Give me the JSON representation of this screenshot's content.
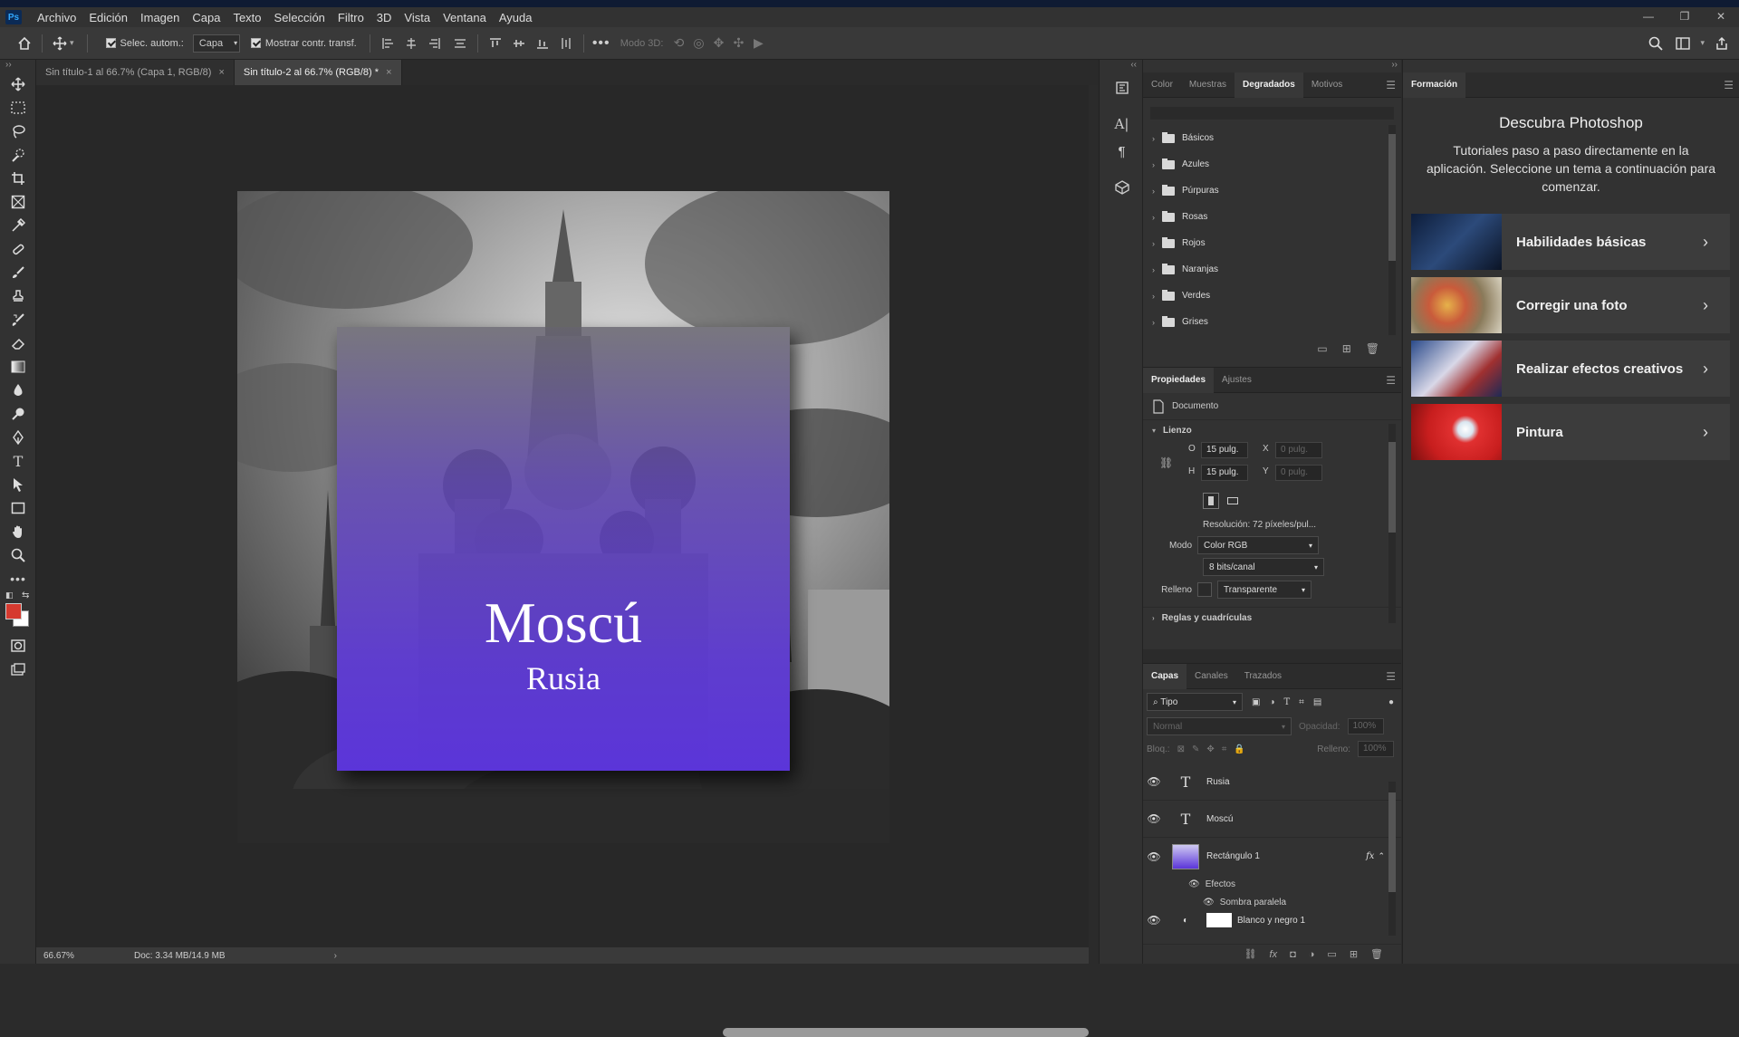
{
  "app": {
    "logo": "Ps"
  },
  "menu": [
    "Archivo",
    "Edición",
    "Imagen",
    "Capa",
    "Texto",
    "Selección",
    "Filtro",
    "3D",
    "Vista",
    "Ventana",
    "Ayuda"
  ],
  "window_controls": [
    "—",
    "❐",
    "✕"
  ],
  "options": {
    "auto_select_label": "Selec. autom.:",
    "auto_select_target": "Capa",
    "show_transform_label": "Mostrar contr. transf.",
    "mode_3d_label": "Modo 3D:"
  },
  "tabs": [
    {
      "label": "Sin título-1 al 66.7% (Capa 1, RGB/8)",
      "close": "×"
    },
    {
      "label": "Sin título-2 al 66.7% (RGB/8) *",
      "close": "×"
    }
  ],
  "artwork": {
    "title": "Moscú",
    "subtitle": "Rusia"
  },
  "status": {
    "zoom": "66.67%",
    "doc": "Doc: 3.34 MB/14.9 MB"
  },
  "gradients_panel": {
    "tabs": [
      "Color",
      "Muestras",
      "Degradados",
      "Motivos"
    ],
    "active_tab": "Degradados",
    "folders": [
      "Básicos",
      "Azules",
      "Púrpuras",
      "Rosas",
      "Rojos",
      "Naranjas",
      "Verdes",
      "Grises"
    ]
  },
  "properties_panel": {
    "tabs": [
      "Propiedades",
      "Ajustes"
    ],
    "doc_label": "Documento",
    "section_canvas": "Lienzo",
    "w_label": "O",
    "w_value": "15 pulg.",
    "h_label": "H",
    "h_value": "15 pulg.",
    "x_label": "X",
    "x_value": "0 pulg.",
    "y_label": "Y",
    "y_value": "0 pulg.",
    "resolution": "Resolución: 72 píxeles/pul...",
    "mode_label": "Modo",
    "mode_value": "Color RGB",
    "bits_value": "8 bits/canal",
    "fill_label": "Relleno",
    "fill_value": "Transparente",
    "section_rulers": "Reglas y cuadrículas"
  },
  "layers_panel": {
    "tabs": [
      "Capas",
      "Canales",
      "Trazados"
    ],
    "filter_kind": "Tipo",
    "blend_mode": "Normal",
    "opacity_label": "Opacidad:",
    "opacity_value": "100%",
    "lock_label": "Bloq.:",
    "fill_label": "Relleno:",
    "fill_value": "100%",
    "layers": [
      {
        "name": "Rusia",
        "kind": "text"
      },
      {
        "name": "Moscú",
        "kind": "text"
      },
      {
        "name": "Rectángulo 1",
        "kind": "shape",
        "fx": "fx"
      }
    ],
    "effects_label": "Efectos",
    "effect_name": "Sombra paralela",
    "bottom_layer": "Blanco y negro 1"
  },
  "learn_panel": {
    "tab": "Formación",
    "heading": "Descubra Photoshop",
    "intro": "Tutoriales paso a paso directamente en la aplicación. Seleccione un tema a continuación para comenzar.",
    "cards": [
      "Habilidades básicas",
      "Corregir una foto",
      "Realizar efectos creativos",
      "Pintura"
    ]
  },
  "colors": {
    "accent_purple": "#5b35d9",
    "foreground_swatch": "#d63a2f",
    "background_swatch": "#ffffff"
  }
}
